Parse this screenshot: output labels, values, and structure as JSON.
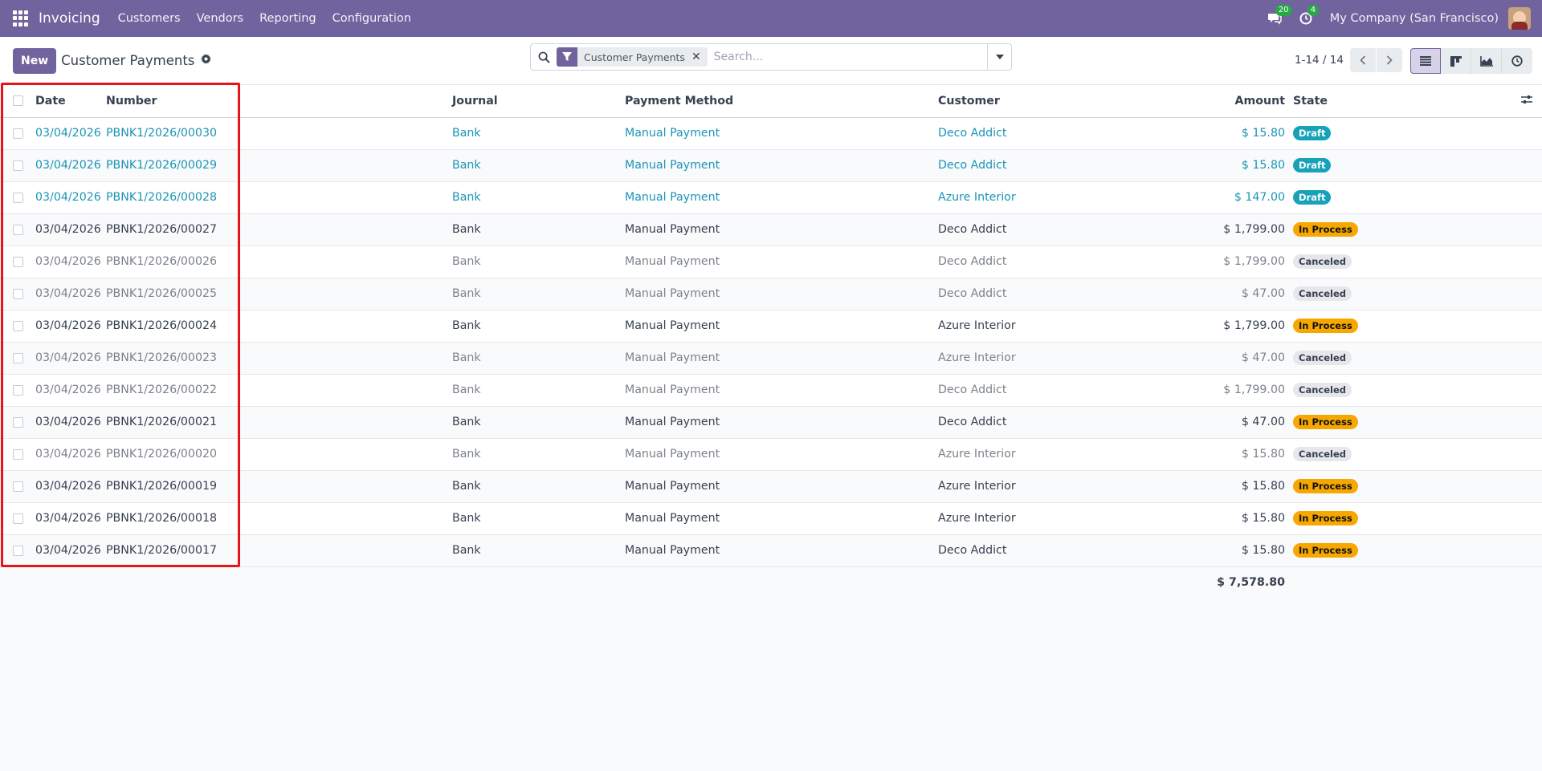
{
  "navbar": {
    "app_name": "Invoicing",
    "menus": [
      "Customers",
      "Vendors",
      "Reporting",
      "Configuration"
    ],
    "messages_count": "20",
    "activities_count": "4",
    "company": "My Company (San Francisco)"
  },
  "control": {
    "new_label": "New",
    "title": "Customer Payments",
    "facet_label": "Customer Payments",
    "search_placeholder": "Search...",
    "pager": "1-14 / 14",
    "views": [
      "list-icon",
      "kanban-icon",
      "graph-icon",
      "activity-icon"
    ]
  },
  "table": {
    "headers": {
      "date": "Date",
      "number": "Number",
      "journal": "Journal",
      "method": "Payment Method",
      "customer": "Customer",
      "amount": "Amount",
      "state": "State"
    },
    "rows": [
      {
        "date": "03/04/2026",
        "number": "PBNK1/2026/00030",
        "journal": "Bank",
        "method": "Manual Payment",
        "customer": "Deco Addict",
        "amount": "$ 15.80",
        "state": "Draft",
        "kind": "draft"
      },
      {
        "date": "03/04/2026",
        "number": "PBNK1/2026/00029",
        "journal": "Bank",
        "method": "Manual Payment",
        "customer": "Deco Addict",
        "amount": "$ 15.80",
        "state": "Draft",
        "kind": "draft"
      },
      {
        "date": "03/04/2026",
        "number": "PBNK1/2026/00028",
        "journal": "Bank",
        "method": "Manual Payment",
        "customer": "Azure Interior",
        "amount": "$ 147.00",
        "state": "Draft",
        "kind": "draft"
      },
      {
        "date": "03/04/2026",
        "number": "PBNK1/2026/00027",
        "journal": "Bank",
        "method": "Manual Payment",
        "customer": "Deco Addict",
        "amount": "$ 1,799.00",
        "state": "In Process",
        "kind": "process"
      },
      {
        "date": "03/04/2026",
        "number": "PBNK1/2026/00026",
        "journal": "Bank",
        "method": "Manual Payment",
        "customer": "Deco Addict",
        "amount": "$ 1,799.00",
        "state": "Canceled",
        "kind": "canceled"
      },
      {
        "date": "03/04/2026",
        "number": "PBNK1/2026/00025",
        "journal": "Bank",
        "method": "Manual Payment",
        "customer": "Deco Addict",
        "amount": "$ 47.00",
        "state": "Canceled",
        "kind": "canceled"
      },
      {
        "date": "03/04/2026",
        "number": "PBNK1/2026/00024",
        "journal": "Bank",
        "method": "Manual Payment",
        "customer": "Azure Interior",
        "amount": "$ 1,799.00",
        "state": "In Process",
        "kind": "process"
      },
      {
        "date": "03/04/2026",
        "number": "PBNK1/2026/00023",
        "journal": "Bank",
        "method": "Manual Payment",
        "customer": "Azure Interior",
        "amount": "$ 47.00",
        "state": "Canceled",
        "kind": "canceled"
      },
      {
        "date": "03/04/2026",
        "number": "PBNK1/2026/00022",
        "journal": "Bank",
        "method": "Manual Payment",
        "customer": "Deco Addict",
        "amount": "$ 1,799.00",
        "state": "Canceled",
        "kind": "canceled"
      },
      {
        "date": "03/04/2026",
        "number": "PBNK1/2026/00021",
        "journal": "Bank",
        "method": "Manual Payment",
        "customer": "Deco Addict",
        "amount": "$ 47.00",
        "state": "In Process",
        "kind": "process"
      },
      {
        "date": "03/04/2026",
        "number": "PBNK1/2026/00020",
        "journal": "Bank",
        "method": "Manual Payment",
        "customer": "Azure Interior",
        "amount": "$ 15.80",
        "state": "Canceled",
        "kind": "canceled"
      },
      {
        "date": "03/04/2026",
        "number": "PBNK1/2026/00019",
        "journal": "Bank",
        "method": "Manual Payment",
        "customer": "Azure Interior",
        "amount": "$ 15.80",
        "state": "In Process",
        "kind": "process"
      },
      {
        "date": "03/04/2026",
        "number": "PBNK1/2026/00018",
        "journal": "Bank",
        "method": "Manual Payment",
        "customer": "Azure Interior",
        "amount": "$ 15.80",
        "state": "In Process",
        "kind": "process"
      },
      {
        "date": "03/04/2026",
        "number": "PBNK1/2026/00017",
        "journal": "Bank",
        "method": "Manual Payment",
        "customer": "Deco Addict",
        "amount": "$ 15.80",
        "state": "In Process",
        "kind": "process"
      }
    ],
    "total_amount": "$ 7,578.80"
  },
  "colors": {
    "brand": "#71639e",
    "draft": "#17a2b8",
    "in_process": "#f7a800",
    "canceled": "#e5e7eb",
    "highlight": "#e8141a"
  }
}
